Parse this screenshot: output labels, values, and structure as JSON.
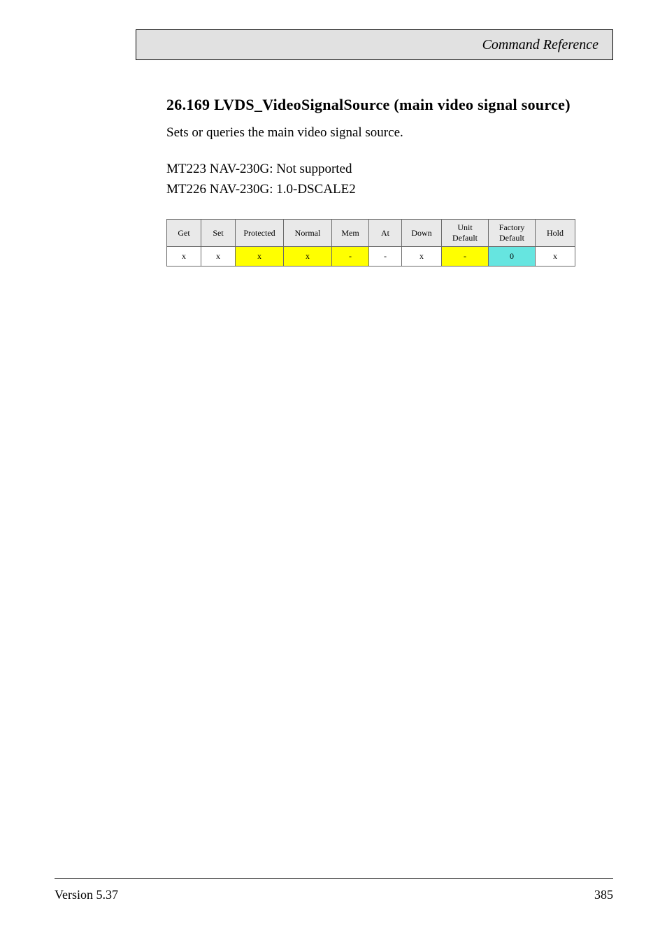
{
  "header": {
    "title": "Command Reference"
  },
  "section": {
    "title": "26.169 LVDS_VideoSignalSource (main video signal source)"
  },
  "body": {
    "description": "Sets or queries the main video signal source.",
    "support_line1": "MT223 NAV-230G: Not supported",
    "support_line2": "MT226 NAV-230G: 1.0-DSCALE2"
  },
  "table": {
    "headers": [
      "Get",
      "Set",
      "Protected",
      "Normal",
      "Mem",
      "At",
      "Down",
      "Unit Default",
      "Factory Default",
      "Hold"
    ],
    "row": {
      "get": "x",
      "set": "x",
      "protected": "x",
      "normal": "x",
      "mem": "-",
      "at": "-",
      "down": "x",
      "unit_default": "-",
      "factory_default": "0",
      "hold": "x"
    }
  },
  "footer": {
    "left": "Version 5.37",
    "right": "385"
  }
}
